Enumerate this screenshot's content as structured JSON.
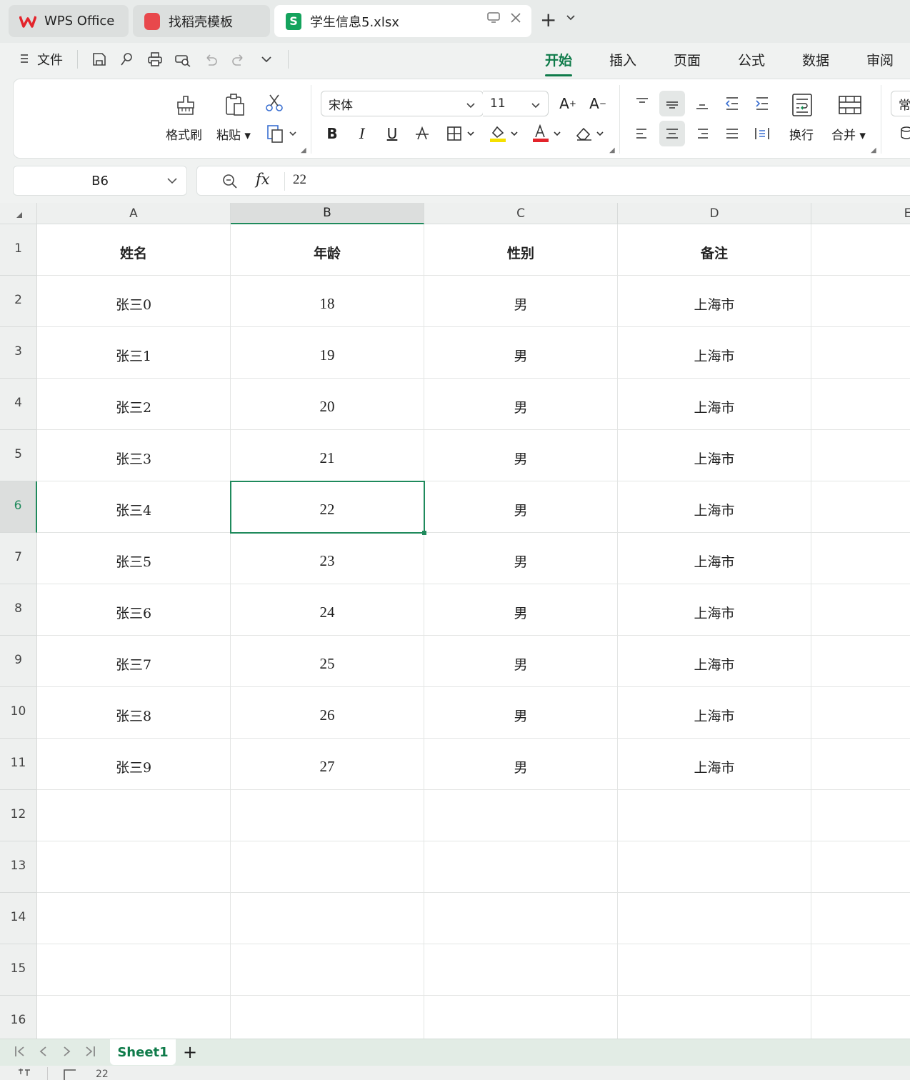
{
  "tabs": [
    {
      "label": "WPS Office",
      "icon": "wps-logo-icon"
    },
    {
      "label": "找稻壳模板",
      "icon": "docer-logo-icon"
    },
    {
      "label": "学生信息5.xlsx",
      "icon": "spreadsheet-s-icon",
      "active": true
    }
  ],
  "menu": {
    "file": "文件",
    "ribbon_tabs": [
      "开始",
      "插入",
      "页面",
      "公式",
      "数据",
      "审阅"
    ],
    "active_tab": "开始"
  },
  "ribbon": {
    "format_painter": "格式刷",
    "paste": "粘贴",
    "font_name": "宋体",
    "font_size": "11",
    "wrap": "换行",
    "merge": "合并",
    "bold": "B",
    "italic": "I",
    "underline": "U",
    "number_format_partial": "常"
  },
  "formula": {
    "name_box": "B6",
    "fx": "fx",
    "value": "22"
  },
  "grid": {
    "columns": [
      "A",
      "B",
      "C",
      "D",
      "E"
    ],
    "rows": [
      "1",
      "2",
      "3",
      "4",
      "5",
      "6",
      "7",
      "8",
      "9",
      "10",
      "11",
      "12",
      "13",
      "14",
      "15",
      "16"
    ],
    "selected_cell": "B6",
    "cells": [
      [
        "姓名",
        "年龄",
        "性别",
        "备注"
      ],
      [
        "张三0",
        "18",
        "男",
        "上海市"
      ],
      [
        "张三1",
        "19",
        "男",
        "上海市"
      ],
      [
        "张三2",
        "20",
        "男",
        "上海市"
      ],
      [
        "张三3",
        "21",
        "男",
        "上海市"
      ],
      [
        "张三4",
        "22",
        "男",
        "上海市"
      ],
      [
        "张三5",
        "23",
        "男",
        "上海市"
      ],
      [
        "张三6",
        "24",
        "男",
        "上海市"
      ],
      [
        "张三7",
        "25",
        "男",
        "上海市"
      ],
      [
        "张三8",
        "26",
        "男",
        "上海市"
      ],
      [
        "张三9",
        "27",
        "男",
        "上海市"
      ]
    ]
  },
  "sheets": {
    "tabs": [
      "Sheet1"
    ],
    "add": "+"
  },
  "status": {
    "value": "22"
  },
  "colors": {
    "accent": "#0f7b4a",
    "selection": "#1f8a5c"
  }
}
